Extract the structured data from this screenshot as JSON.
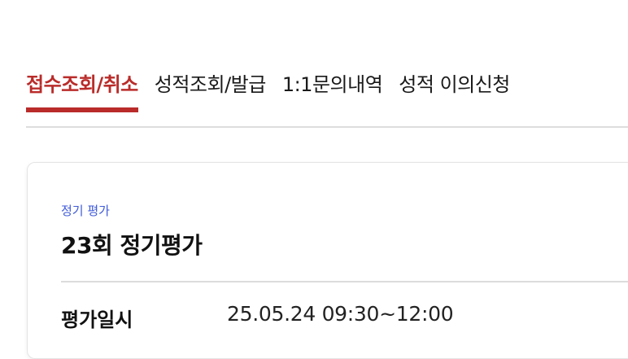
{
  "tabs": [
    {
      "label": "접수조회/취소",
      "active": true
    },
    {
      "label": "성적조회/발급",
      "active": false
    },
    {
      "label": "1:1문의내역",
      "active": false
    },
    {
      "label": "성적 이의신청",
      "active": false
    }
  ],
  "card": {
    "category": "정기 평가",
    "title": "23회 정기평가",
    "info": {
      "label": "평가일시",
      "value": "25.05.24 09:30~12:00"
    }
  },
  "colors": {
    "accent": "#b92c2a",
    "category": "#3f5ad8"
  }
}
